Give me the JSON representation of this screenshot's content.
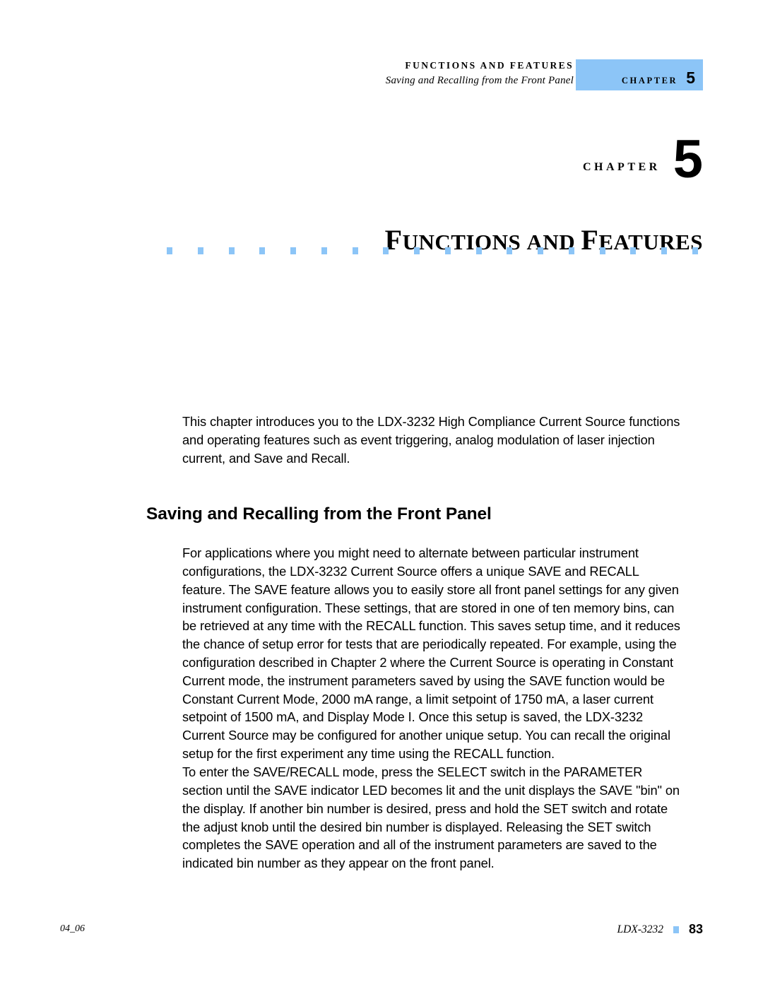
{
  "header": {
    "title": "FUNCTIONS AND FEATURES",
    "subtitle": "Saving and Recalling from the Front Panel",
    "chip_label": "CHAPTER",
    "chip_number": "5"
  },
  "chapter_opener": {
    "kicker_label": "CHAPTER",
    "kicker_number": "5",
    "title_part1_cap": "F",
    "title_part1_rest": "UNCTIONS",
    "title_and": "AND",
    "title_part2_cap": "F",
    "title_part2_rest": "EATURES",
    "rule_square_count": 18,
    "rule_color": "#8CC5F7"
  },
  "main": {
    "intro_paragraph": "This chapter introduces you to the LDX-3232 High Compliance Current Source functions and operating features such as event triggering, analog modulation of laser injection current, and Save and Recall.",
    "section_heading": "Saving and Recalling from the Front Panel",
    "paragraph_1": "For applications where you might need to alternate between particular instrument configurations, the LDX-3232 Current Source offers a unique SAVE and RECALL feature. The SAVE feature allows you to easily store all front panel settings for any given instrument configuration. These settings, that are stored in one of ten memory bins, can be retrieved at any time with the RECALL function. This saves setup time, and it reduces the chance of setup error for tests that are periodically repeated.  For example, using the configuration described in Chapter 2 where the Current Source is operating in Constant Current mode, the instrument parameters saved by using the SAVE function would be Constant Current Mode, 2000 mA range, a limit setpoint of 1750 mA, a laser current setpoint of 1500 mA, and Display Mode I. Once this setup is saved, the LDX-3232 Current Source may be configured for another unique setup. You can recall the original setup for the first experiment any time using the RECALL function.",
    "paragraph_2": "To enter the SAVE/RECALL mode, press the SELECT switch in the PARAMETER section until the SAVE indicator LED becomes lit and the unit displays the SAVE \"bin\" on the display. If another bin number is desired, press and hold the SET switch and rotate the adjust knob until the desired bin number is displayed. Releasing the SET switch completes the SAVE operation and all of the instrument parameters are saved to the indicated bin number as they appear on the front panel."
  },
  "footer": {
    "revision": "04_06",
    "document": "LDX-3232",
    "page_number": "83"
  }
}
